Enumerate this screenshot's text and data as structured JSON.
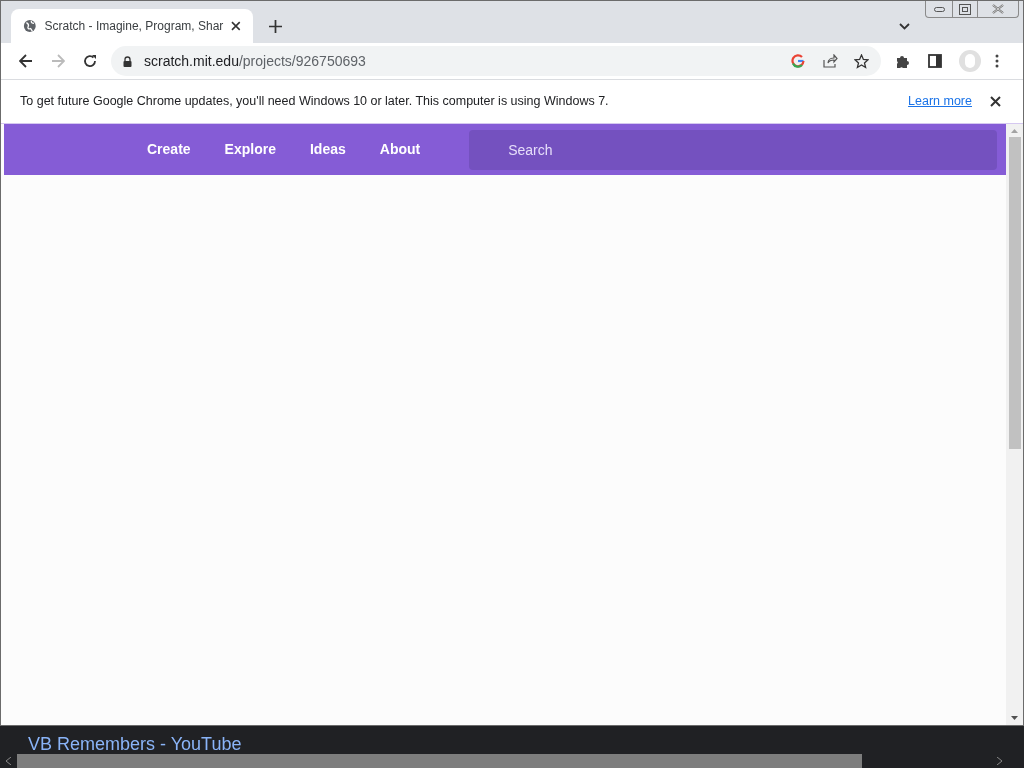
{
  "browser": {
    "tab": {
      "title": "Scratch - Imagine, Program, Shar",
      "selected": true
    },
    "address": {
      "host": "scratch.mit.edu",
      "path": "/projects/926750693"
    },
    "infobar": {
      "message": "To get future Google Chrome updates, you'll need Windows 10 or later. This computer is using Windows 7.",
      "link": "Learn more"
    }
  },
  "page": {
    "nav": [
      {
        "label": "Create"
      },
      {
        "label": "Explore"
      },
      {
        "label": "Ideas"
      },
      {
        "label": "About"
      }
    ],
    "search": {
      "placeholder": "Search"
    }
  },
  "background_window": {
    "title": "VB Remembers - YouTube"
  }
}
